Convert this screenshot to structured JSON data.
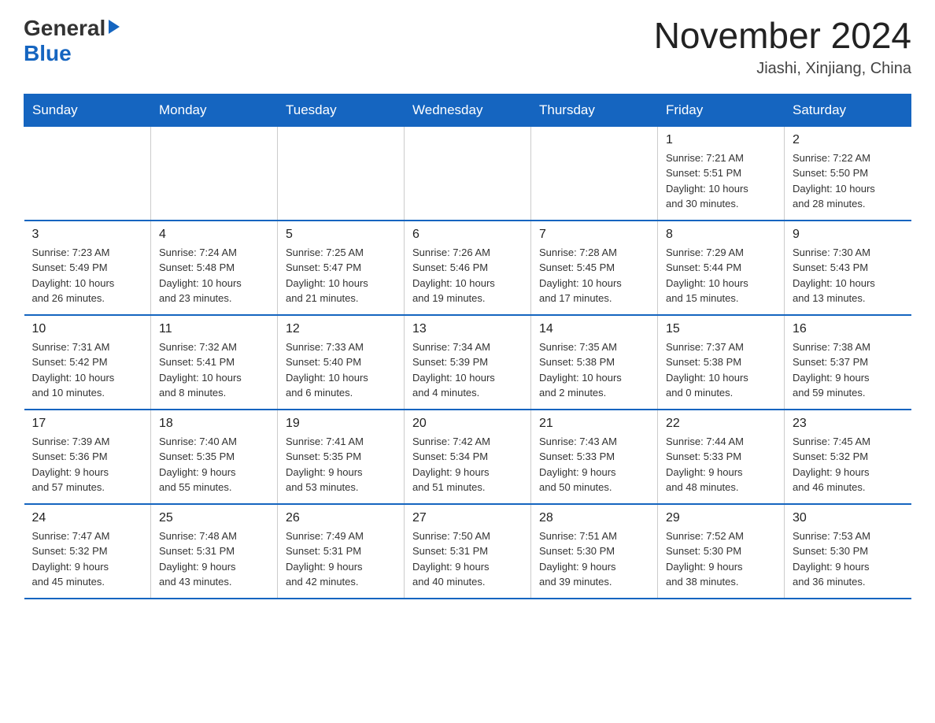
{
  "header": {
    "logo_general": "General",
    "logo_blue": "Blue",
    "title": "November 2024",
    "subtitle": "Jiashi, Xinjiang, China"
  },
  "weekdays": [
    "Sunday",
    "Monday",
    "Tuesday",
    "Wednesday",
    "Thursday",
    "Friday",
    "Saturday"
  ],
  "weeks": [
    {
      "days": [
        {
          "number": "",
          "info": "",
          "empty": true
        },
        {
          "number": "",
          "info": "",
          "empty": true
        },
        {
          "number": "",
          "info": "",
          "empty": true
        },
        {
          "number": "",
          "info": "",
          "empty": true
        },
        {
          "number": "",
          "info": "",
          "empty": true
        },
        {
          "number": "1",
          "info": "Sunrise: 7:21 AM\nSunset: 5:51 PM\nDaylight: 10 hours\nand 30 minutes."
        },
        {
          "number": "2",
          "info": "Sunrise: 7:22 AM\nSunset: 5:50 PM\nDaylight: 10 hours\nand 28 minutes."
        }
      ]
    },
    {
      "days": [
        {
          "number": "3",
          "info": "Sunrise: 7:23 AM\nSunset: 5:49 PM\nDaylight: 10 hours\nand 26 minutes."
        },
        {
          "number": "4",
          "info": "Sunrise: 7:24 AM\nSunset: 5:48 PM\nDaylight: 10 hours\nand 23 minutes."
        },
        {
          "number": "5",
          "info": "Sunrise: 7:25 AM\nSunset: 5:47 PM\nDaylight: 10 hours\nand 21 minutes."
        },
        {
          "number": "6",
          "info": "Sunrise: 7:26 AM\nSunset: 5:46 PM\nDaylight: 10 hours\nand 19 minutes."
        },
        {
          "number": "7",
          "info": "Sunrise: 7:28 AM\nSunset: 5:45 PM\nDaylight: 10 hours\nand 17 minutes."
        },
        {
          "number": "8",
          "info": "Sunrise: 7:29 AM\nSunset: 5:44 PM\nDaylight: 10 hours\nand 15 minutes."
        },
        {
          "number": "9",
          "info": "Sunrise: 7:30 AM\nSunset: 5:43 PM\nDaylight: 10 hours\nand 13 minutes."
        }
      ]
    },
    {
      "days": [
        {
          "number": "10",
          "info": "Sunrise: 7:31 AM\nSunset: 5:42 PM\nDaylight: 10 hours\nand 10 minutes."
        },
        {
          "number": "11",
          "info": "Sunrise: 7:32 AM\nSunset: 5:41 PM\nDaylight: 10 hours\nand 8 minutes."
        },
        {
          "number": "12",
          "info": "Sunrise: 7:33 AM\nSunset: 5:40 PM\nDaylight: 10 hours\nand 6 minutes."
        },
        {
          "number": "13",
          "info": "Sunrise: 7:34 AM\nSunset: 5:39 PM\nDaylight: 10 hours\nand 4 minutes."
        },
        {
          "number": "14",
          "info": "Sunrise: 7:35 AM\nSunset: 5:38 PM\nDaylight: 10 hours\nand 2 minutes."
        },
        {
          "number": "15",
          "info": "Sunrise: 7:37 AM\nSunset: 5:38 PM\nDaylight: 10 hours\nand 0 minutes."
        },
        {
          "number": "16",
          "info": "Sunrise: 7:38 AM\nSunset: 5:37 PM\nDaylight: 9 hours\nand 59 minutes."
        }
      ]
    },
    {
      "days": [
        {
          "number": "17",
          "info": "Sunrise: 7:39 AM\nSunset: 5:36 PM\nDaylight: 9 hours\nand 57 minutes."
        },
        {
          "number": "18",
          "info": "Sunrise: 7:40 AM\nSunset: 5:35 PM\nDaylight: 9 hours\nand 55 minutes."
        },
        {
          "number": "19",
          "info": "Sunrise: 7:41 AM\nSunset: 5:35 PM\nDaylight: 9 hours\nand 53 minutes."
        },
        {
          "number": "20",
          "info": "Sunrise: 7:42 AM\nSunset: 5:34 PM\nDaylight: 9 hours\nand 51 minutes."
        },
        {
          "number": "21",
          "info": "Sunrise: 7:43 AM\nSunset: 5:33 PM\nDaylight: 9 hours\nand 50 minutes."
        },
        {
          "number": "22",
          "info": "Sunrise: 7:44 AM\nSunset: 5:33 PM\nDaylight: 9 hours\nand 48 minutes."
        },
        {
          "number": "23",
          "info": "Sunrise: 7:45 AM\nSunset: 5:32 PM\nDaylight: 9 hours\nand 46 minutes."
        }
      ]
    },
    {
      "days": [
        {
          "number": "24",
          "info": "Sunrise: 7:47 AM\nSunset: 5:32 PM\nDaylight: 9 hours\nand 45 minutes."
        },
        {
          "number": "25",
          "info": "Sunrise: 7:48 AM\nSunset: 5:31 PM\nDaylight: 9 hours\nand 43 minutes."
        },
        {
          "number": "26",
          "info": "Sunrise: 7:49 AM\nSunset: 5:31 PM\nDaylight: 9 hours\nand 42 minutes."
        },
        {
          "number": "27",
          "info": "Sunrise: 7:50 AM\nSunset: 5:31 PM\nDaylight: 9 hours\nand 40 minutes."
        },
        {
          "number": "28",
          "info": "Sunrise: 7:51 AM\nSunset: 5:30 PM\nDaylight: 9 hours\nand 39 minutes."
        },
        {
          "number": "29",
          "info": "Sunrise: 7:52 AM\nSunset: 5:30 PM\nDaylight: 9 hours\nand 38 minutes."
        },
        {
          "number": "30",
          "info": "Sunrise: 7:53 AM\nSunset: 5:30 PM\nDaylight: 9 hours\nand 36 minutes."
        }
      ]
    }
  ]
}
